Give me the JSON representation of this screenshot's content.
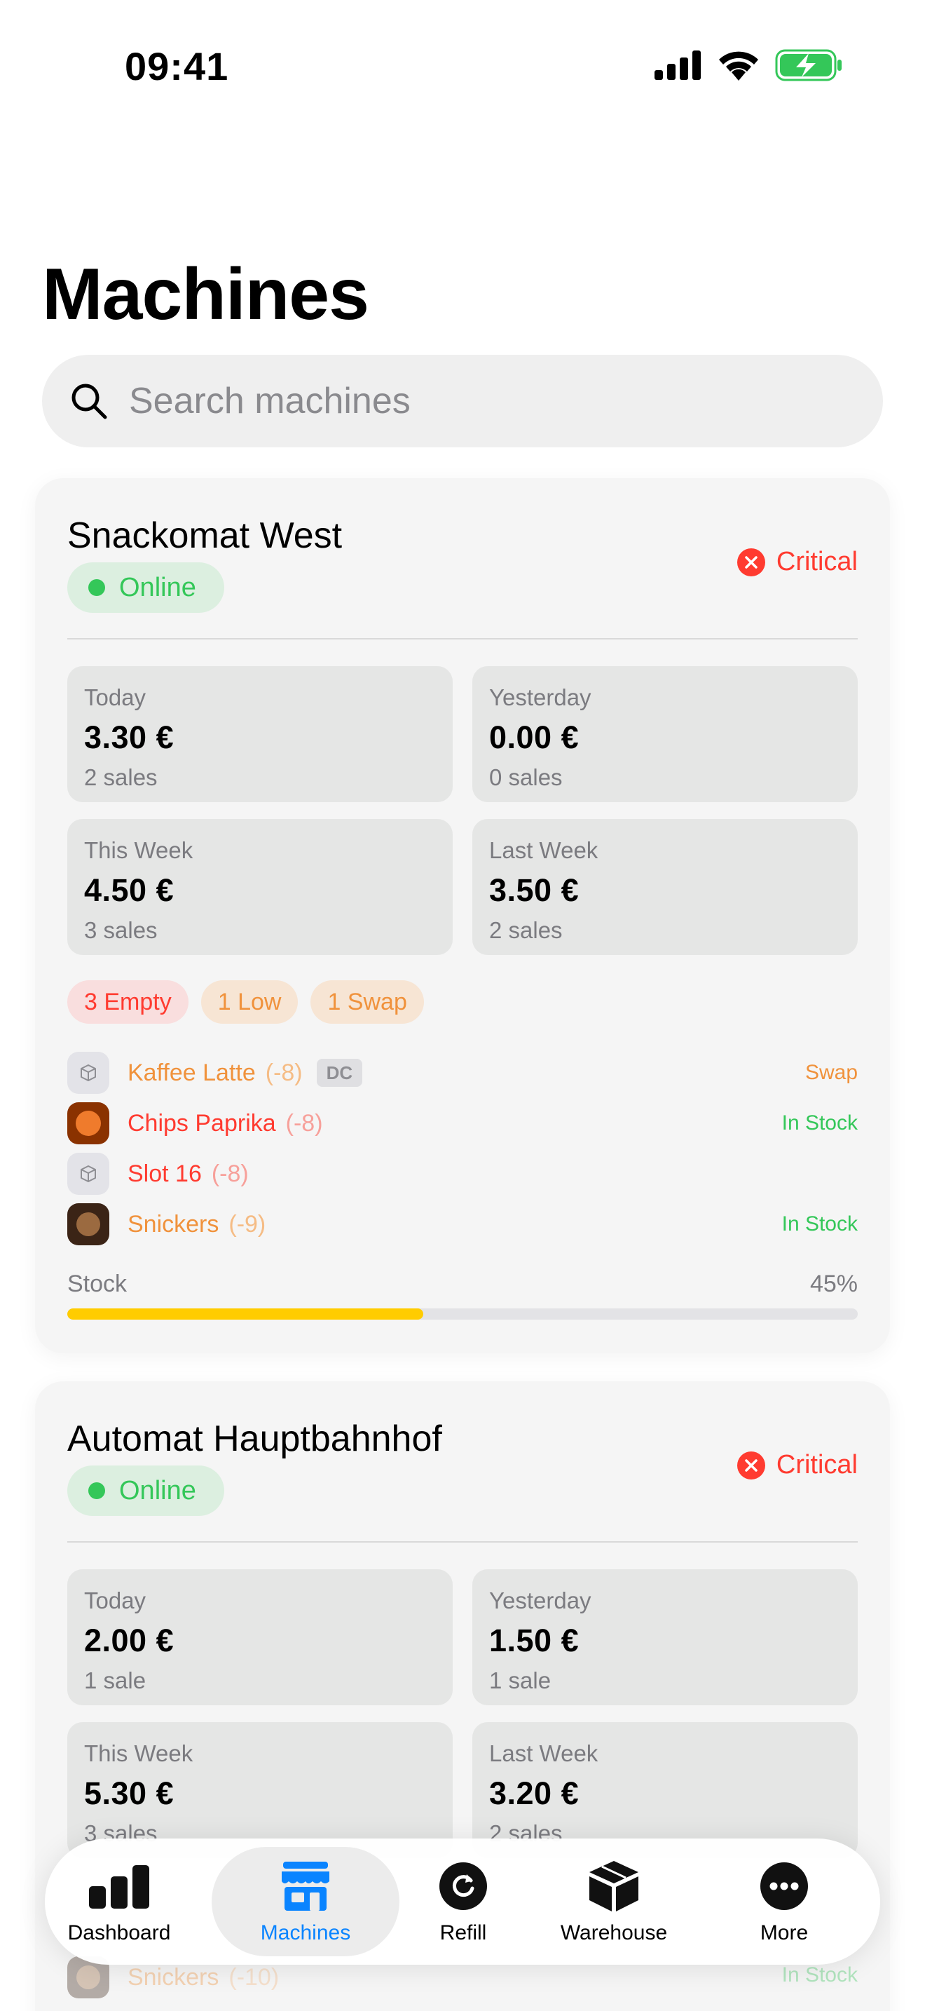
{
  "status_bar": {
    "time": "09:41"
  },
  "page": {
    "title": "Machines"
  },
  "search": {
    "placeholder": "Search machines"
  },
  "machines": [
    {
      "name": "Snackomat West",
      "status": "Online",
      "severity": "Critical",
      "stats": {
        "today": {
          "label": "Today",
          "value": "3.30 €",
          "sales": "2 sales"
        },
        "yesterday": {
          "label": "Yesterday",
          "value": "0.00 €",
          "sales": "0 sales"
        },
        "this_week": {
          "label": "This Week",
          "value": "4.50 €",
          "sales": "3 sales"
        },
        "last_week": {
          "label": "Last Week",
          "value": "3.50 €",
          "sales": "2 sales"
        }
      },
      "badges": {
        "empty": "3 Empty",
        "low": "1 Low",
        "swap": "1 Swap"
      },
      "slots": [
        {
          "name": "Kaffee Latte",
          "delta": "(-8)",
          "tag": "DC",
          "state": "Swap",
          "icon": "package-icon"
        },
        {
          "name": "Chips Paprika",
          "delta": "(-8)",
          "state": "In Stock",
          "icon": "chips-product-image"
        },
        {
          "name": "Slot 16",
          "delta": "(-8)",
          "icon": "package-icon"
        },
        {
          "name": "Snickers",
          "delta": "(-9)",
          "state": "In Stock",
          "icon": "snickers-product-image"
        }
      ],
      "stock": {
        "label": "Stock",
        "percent_label": "45%",
        "level": 45
      }
    },
    {
      "name": "Automat Hauptbahnhof",
      "status": "Online",
      "severity": "Critical",
      "stats": {
        "today": {
          "label": "Today",
          "value": "2.00 €",
          "sales": "1 sale"
        },
        "yesterday": {
          "label": "Yesterday",
          "value": "1.50 €",
          "sales": "1 sale"
        },
        "this_week": {
          "label": "This Week",
          "value": "5.30 €",
          "sales": "3 sales"
        },
        "last_week": {
          "label": "Last Week",
          "value": "3.20 €",
          "sales": "2 sales"
        }
      },
      "peek_slot": {
        "name": "Snickers",
        "delta": "(-10)",
        "state": "In Stock"
      }
    }
  ],
  "tabbar": {
    "dashboard": "Dashboard",
    "machines": "Machines",
    "refill": "Refill",
    "warehouse": "Warehouse",
    "more": "More"
  },
  "colors": {
    "accent": "#0a84ff",
    "online": "#34c759",
    "critical": "#ff3b30",
    "warning": "#f0923c",
    "stock_fill": "#ffcc00"
  }
}
